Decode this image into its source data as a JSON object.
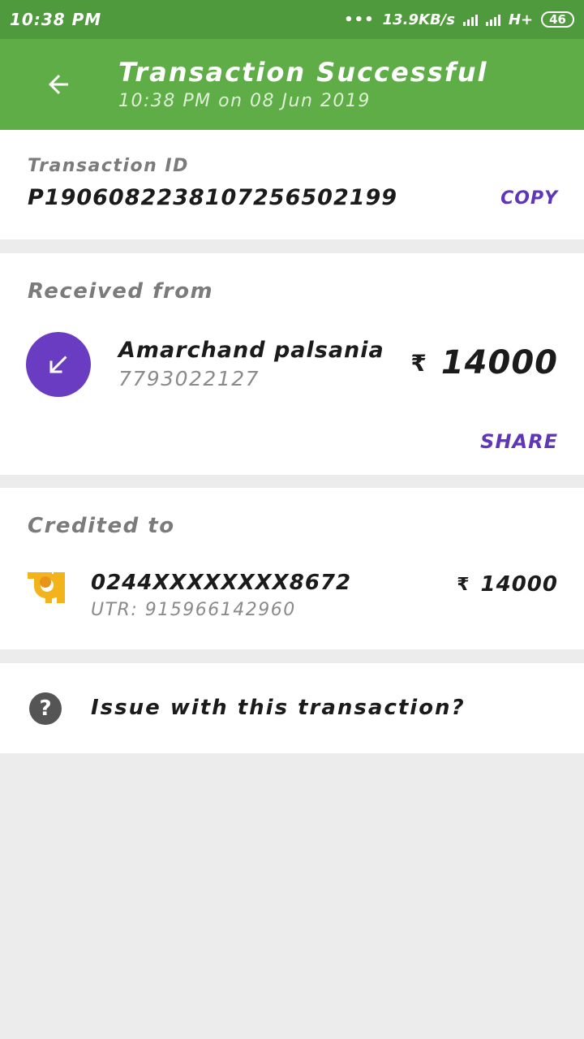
{
  "status_bar": {
    "time": "10:38 PM",
    "dots": "•••",
    "network_speed": "13.9KB/s",
    "network_type": "H+",
    "battery": "46"
  },
  "app_bar": {
    "back_icon": "arrow-left-icon",
    "title": "Transaction Successful",
    "subtitle": "10:38 PM on 08 Jun 2019"
  },
  "transaction": {
    "label": "Transaction ID",
    "id": "P1906082238107256502199",
    "copy_label": "COPY"
  },
  "received": {
    "label": "Received from",
    "avatar_icon": "arrow-down-left-icon",
    "name": "Amarchand palsania",
    "phone": "7793022127",
    "currency": "₹",
    "amount": "14000",
    "share_label": "SHARE"
  },
  "credited": {
    "label": "Credited to",
    "bank_icon": "bank-logo-icon",
    "account": "0244XXXXXXXX8672",
    "utr": "UTR: 915966142960",
    "currency": "₹",
    "amount": "14000"
  },
  "issue": {
    "icon": "help-icon",
    "text": "Issue with this transaction?"
  },
  "colors": {
    "status_bar": "#4f9a3c",
    "app_bar": "#5fad47",
    "accent": "#5f36b8",
    "background": "#ececec"
  }
}
